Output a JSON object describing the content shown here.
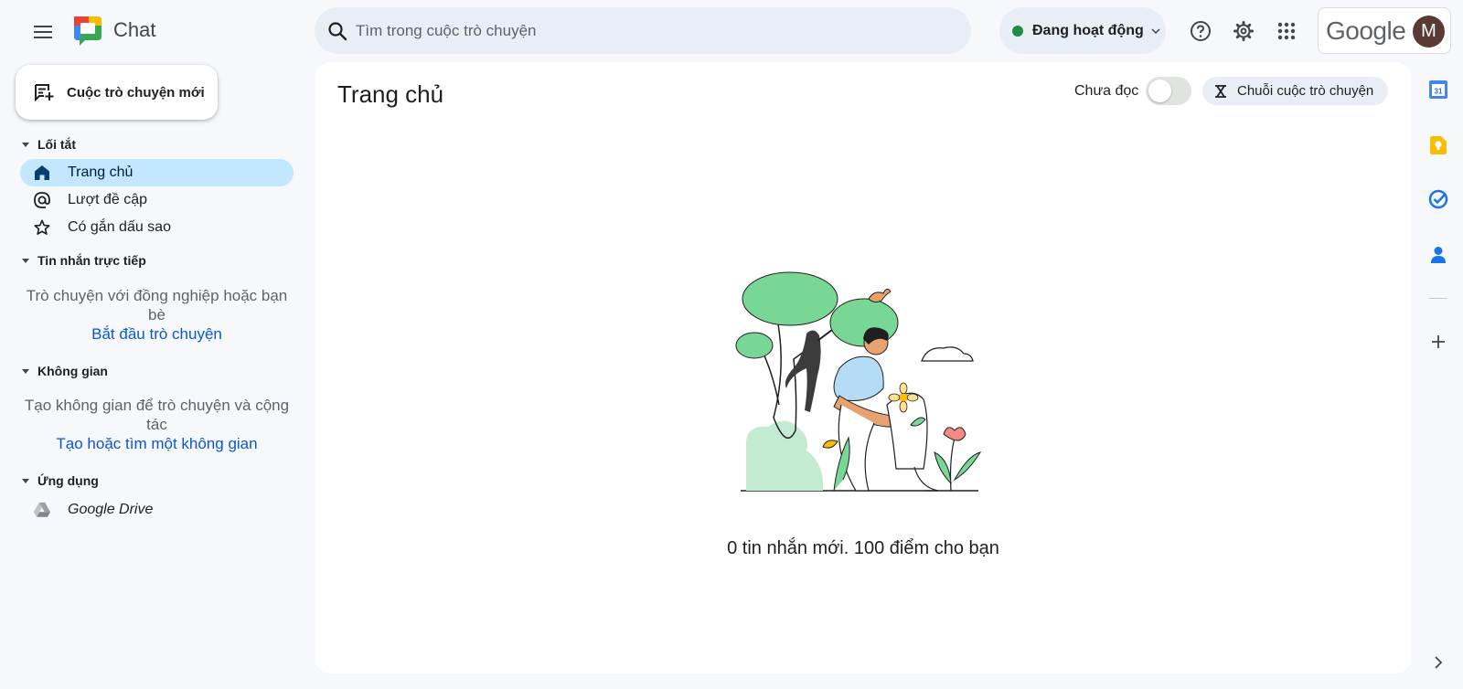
{
  "header": {
    "app_title": "Chat",
    "search_placeholder": "Tìm trong cuộc trò chuyện",
    "status_label": "Đang hoạt động",
    "account_brand": "Google",
    "avatar_initial": "M"
  },
  "sidebar": {
    "new_chat_label": "Cuộc trò chuyện mới",
    "shortcuts": {
      "title": "Lối tắt",
      "items": [
        {
          "label": "Trang chủ",
          "icon": "home-icon",
          "active": true
        },
        {
          "label": "Lượt đề cập",
          "icon": "at-icon",
          "active": false
        },
        {
          "label": "Có gắn dấu sao",
          "icon": "star-icon",
          "active": false
        }
      ]
    },
    "direct_messages": {
      "title": "Tin nhắn trực tiếp",
      "empty_text": "Trò chuyện với đồng nghiệp hoặc bạn bè",
      "link": "Bắt đầu trò chuyện"
    },
    "spaces": {
      "title": "Không gian",
      "empty_text": "Tạo không gian để trò chuyện và cộng tác",
      "link": "Tạo hoặc tìm một không gian"
    },
    "apps": {
      "title": "Ứng dụng",
      "items": [
        {
          "label": "Google Drive",
          "icon": "google-drive-icon"
        }
      ]
    }
  },
  "main": {
    "title": "Trang chủ",
    "unread_label": "Chưa đọc",
    "unread_toggle_on": false,
    "threads_button": "Chuỗi cuộc trò chuyện",
    "empty_message": "0 tin nhắn mới. 100 điểm cho bạn"
  },
  "right_rail": {
    "calendar_day": "31",
    "icons": [
      "calendar-icon",
      "keep-icon",
      "tasks-icon",
      "contacts-icon",
      "add-icon",
      "expand-icon"
    ]
  },
  "colors": {
    "accent": "#0b57d0",
    "active_nav": "#c2e7ff",
    "status_green": "#1e8e3e",
    "page_bg": "#f6f8fc"
  }
}
